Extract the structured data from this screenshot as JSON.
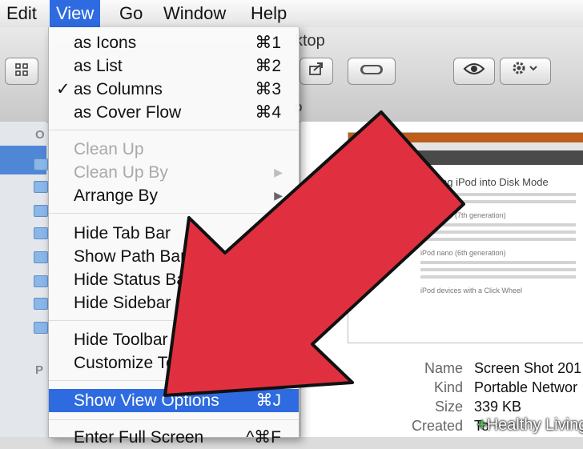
{
  "menubar": {
    "items": [
      {
        "label": "Edit"
      },
      {
        "label": "View"
      },
      {
        "label": "Go"
      },
      {
        "label": "Window"
      },
      {
        "label": "Help"
      }
    ]
  },
  "window": {
    "title_fragment": "ktop",
    "path_fragment": "p"
  },
  "sidebar": {
    "favorites_fragment": "O",
    "places_fragment": "P"
  },
  "view_menu": {
    "items": [
      {
        "label": "as Icons",
        "shortcut": "⌘1"
      },
      {
        "label": "as List",
        "shortcut": "⌘2"
      },
      {
        "label": "as Columns",
        "shortcut": "⌘3",
        "checked": "✓"
      },
      {
        "label": "as Cover Flow",
        "shortcut": "⌘4"
      },
      {
        "label": "Clean Up"
      },
      {
        "label": "Clean Up By",
        "submenu": "▶"
      },
      {
        "label": "Arrange By",
        "submenu": "▶"
      },
      {
        "label": "Hide Tab Bar"
      },
      {
        "label": "Show Path Bar"
      },
      {
        "label": "Hide Status Bar"
      },
      {
        "label": "Hide Sidebar"
      },
      {
        "label": "Hide Toolbar"
      },
      {
        "label": "Customize Toolbar..."
      },
      {
        "label": "Show View Options",
        "shortcut": "⌘J"
      },
      {
        "label": "Enter Full Screen",
        "shortcut": "^⌘F"
      }
    ]
  },
  "preview": {
    "heading": "Putting iPod into Disk Mode",
    "sub1": "iPod nano (7th generation)",
    "sub2": "iPod nano (6th generation)",
    "sub3": "iPod devices with a Click Wheel"
  },
  "info": {
    "rows": [
      {
        "key": "Name",
        "value": "Screen Shot 201"
      },
      {
        "key": "Kind",
        "value": "Portable Networ"
      },
      {
        "key": "Size",
        "value": "339 KB"
      },
      {
        "key": "Created",
        "value": "To"
      }
    ]
  },
  "watermark": {
    "text": "Healthy Living",
    "plus": "+"
  },
  "colors": {
    "menu_highlight": "#2f6be0",
    "arrow_red": "#e0303f",
    "arrow_outline": "#111111"
  },
  "icons": [
    "grid-icon",
    "share-icon",
    "toggle-icon",
    "eye-icon",
    "gear-icon",
    "folder-icon",
    "checkmark-icon",
    "submenu-arrow-icon"
  ]
}
